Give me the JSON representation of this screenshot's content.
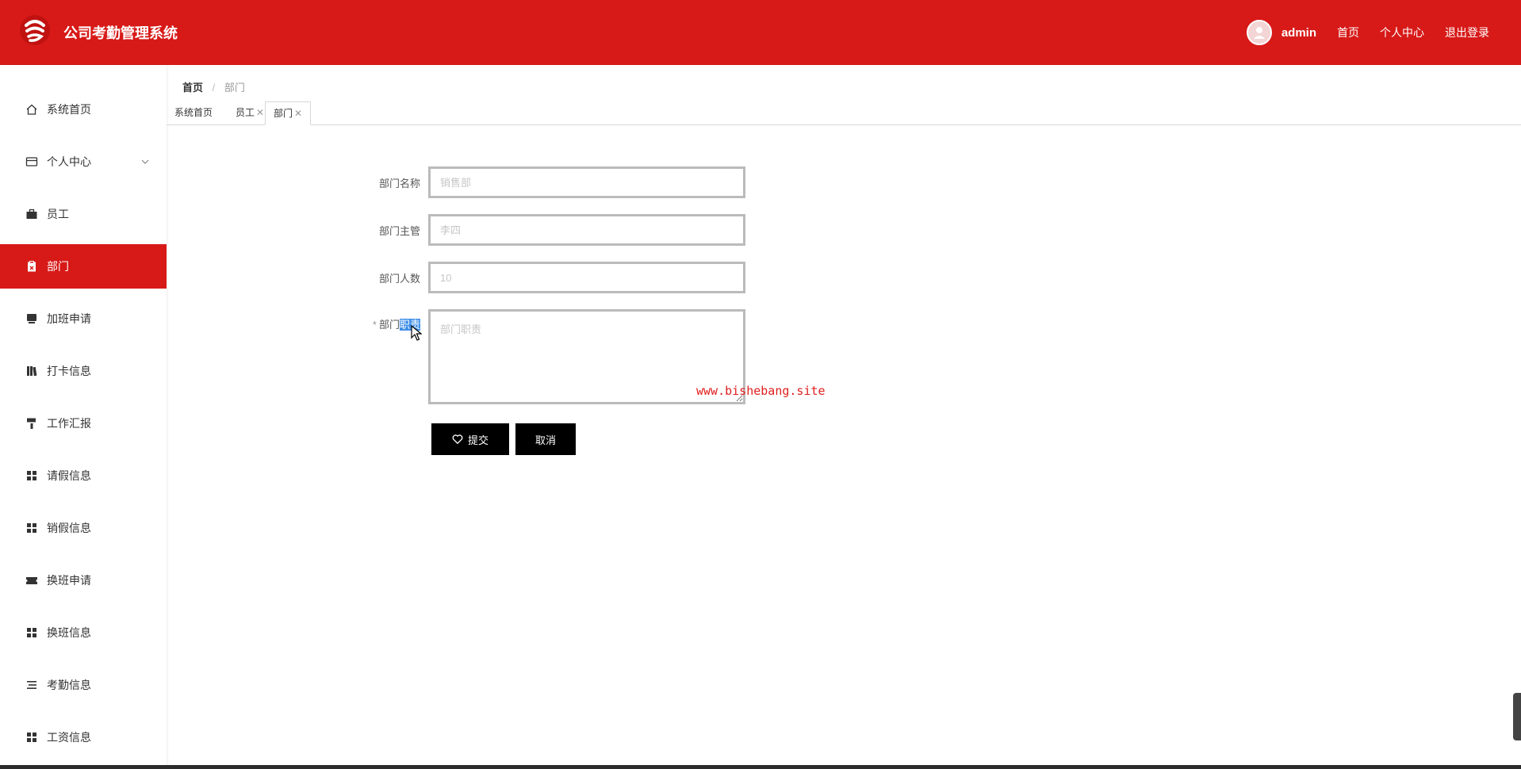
{
  "app": {
    "title": "公司考勤管理系统"
  },
  "header": {
    "user": "admin",
    "links": [
      "首页",
      "个人中心",
      "退出登录"
    ]
  },
  "sidebar": {
    "items": [
      {
        "label": "系统首页",
        "icon": "home-icon"
      },
      {
        "label": "个人中心",
        "icon": "wallet-icon",
        "expandable": true
      },
      {
        "label": "员工",
        "icon": "briefcase-icon"
      },
      {
        "label": "部门",
        "icon": "clipboard-icon",
        "active": true
      },
      {
        "label": "加班申请",
        "icon": "monitor-icon"
      },
      {
        "label": "打卡信息",
        "icon": "books-icon"
      },
      {
        "label": "工作汇报",
        "icon": "paint-roller-icon"
      },
      {
        "label": "请假信息",
        "icon": "grid-icon"
      },
      {
        "label": "销假信息",
        "icon": "grid-icon"
      },
      {
        "label": "换班申请",
        "icon": "ticket-icon"
      },
      {
        "label": "换班信息",
        "icon": "grid-icon"
      },
      {
        "label": "考勤信息",
        "icon": "list-icon"
      },
      {
        "label": "工资信息",
        "icon": "grid-icon"
      }
    ]
  },
  "breadcrumb": {
    "home": "首页",
    "current": "部门"
  },
  "tabs": [
    {
      "label": "系统首页",
      "closable": false
    },
    {
      "label": "员工",
      "closable": true
    },
    {
      "label": "部门",
      "closable": true,
      "active": true
    }
  ],
  "form": {
    "name": {
      "label": "部门名称",
      "placeholder": "销售部"
    },
    "manager": {
      "label": "部门主管",
      "placeholder": "李四"
    },
    "count": {
      "label": "部门人数",
      "placeholder": "10"
    },
    "duty": {
      "label_prefix": "部门",
      "label_selected": "职责",
      "placeholder": "部门职责",
      "required_mark": "*"
    },
    "submit_label": "提交",
    "cancel_label": "取消"
  },
  "watermark": "www.bishebang.site",
  "colors": {
    "brand": "#d71a18",
    "button": "#000000"
  }
}
